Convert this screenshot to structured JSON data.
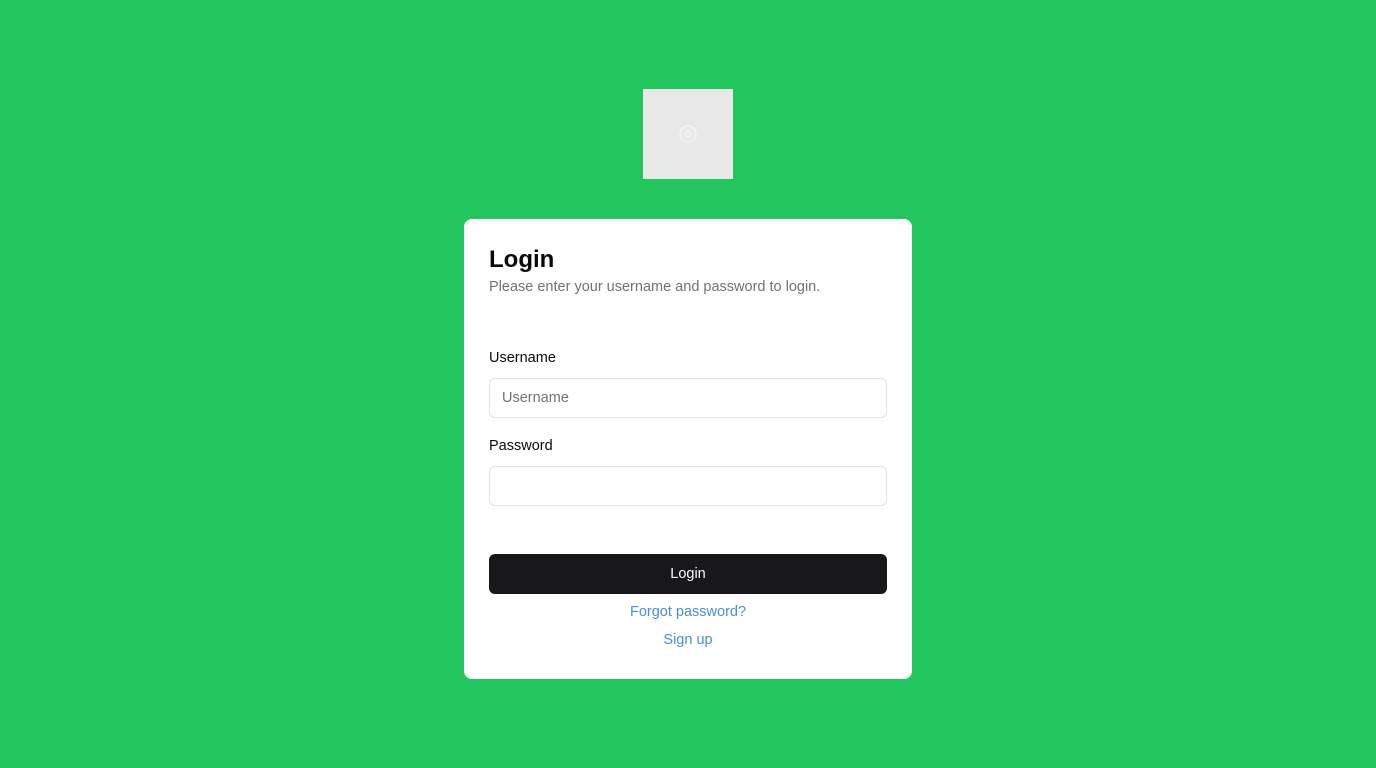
{
  "theme": {
    "background": "#22c55e",
    "card_background": "#ffffff",
    "button_background": "#18181b",
    "link_color": "#4a8fd8"
  },
  "logo": {
    "icon": "logo-placeholder-icon"
  },
  "login_form": {
    "title": "Login",
    "subtitle": "Please enter your username and password to login.",
    "username": {
      "label": "Username",
      "placeholder": "Username",
      "value": ""
    },
    "password": {
      "label": "Password",
      "placeholder": "",
      "value": ""
    },
    "submit_label": "Login",
    "forgot_password_label": "Forgot password?",
    "sign_up_label": "Sign up"
  }
}
